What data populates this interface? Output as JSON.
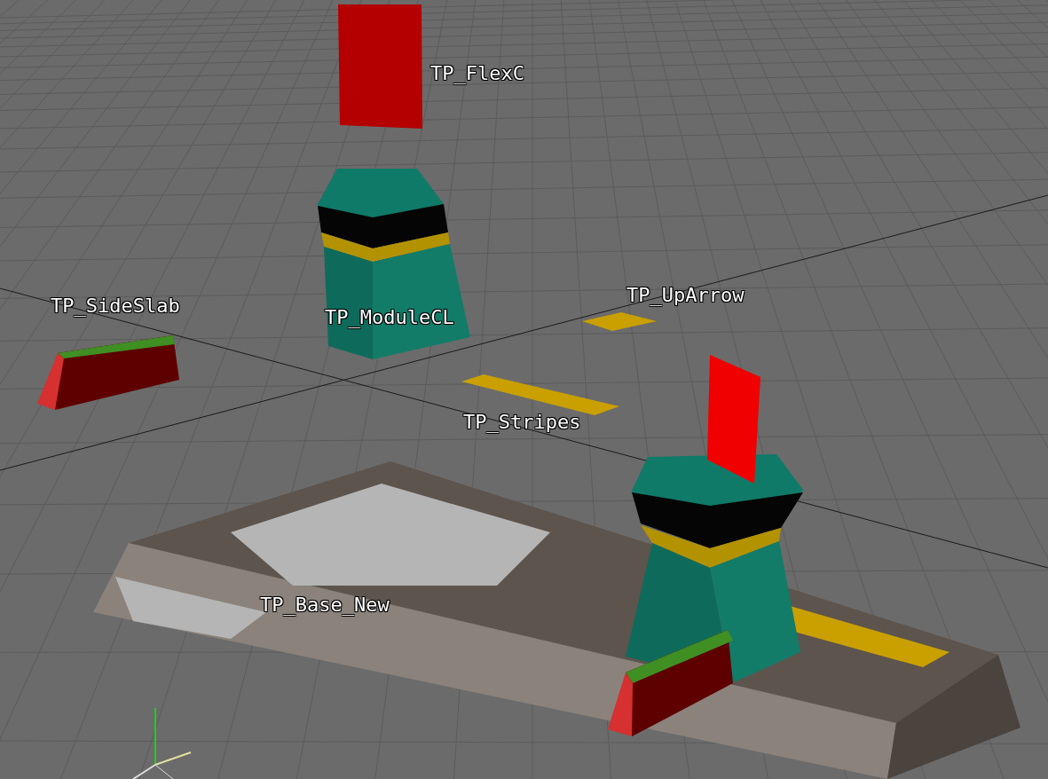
{
  "viewport": {
    "object_labels": [
      {
        "text": "TP_FlexC"
      },
      {
        "text": "TP_SideSlab"
      },
      {
        "text": "TP_ModuleCL"
      },
      {
        "text": "TP_UpArrow"
      },
      {
        "text": "TP_Stripes"
      },
      {
        "text": "TP_Base_New"
      }
    ]
  }
}
